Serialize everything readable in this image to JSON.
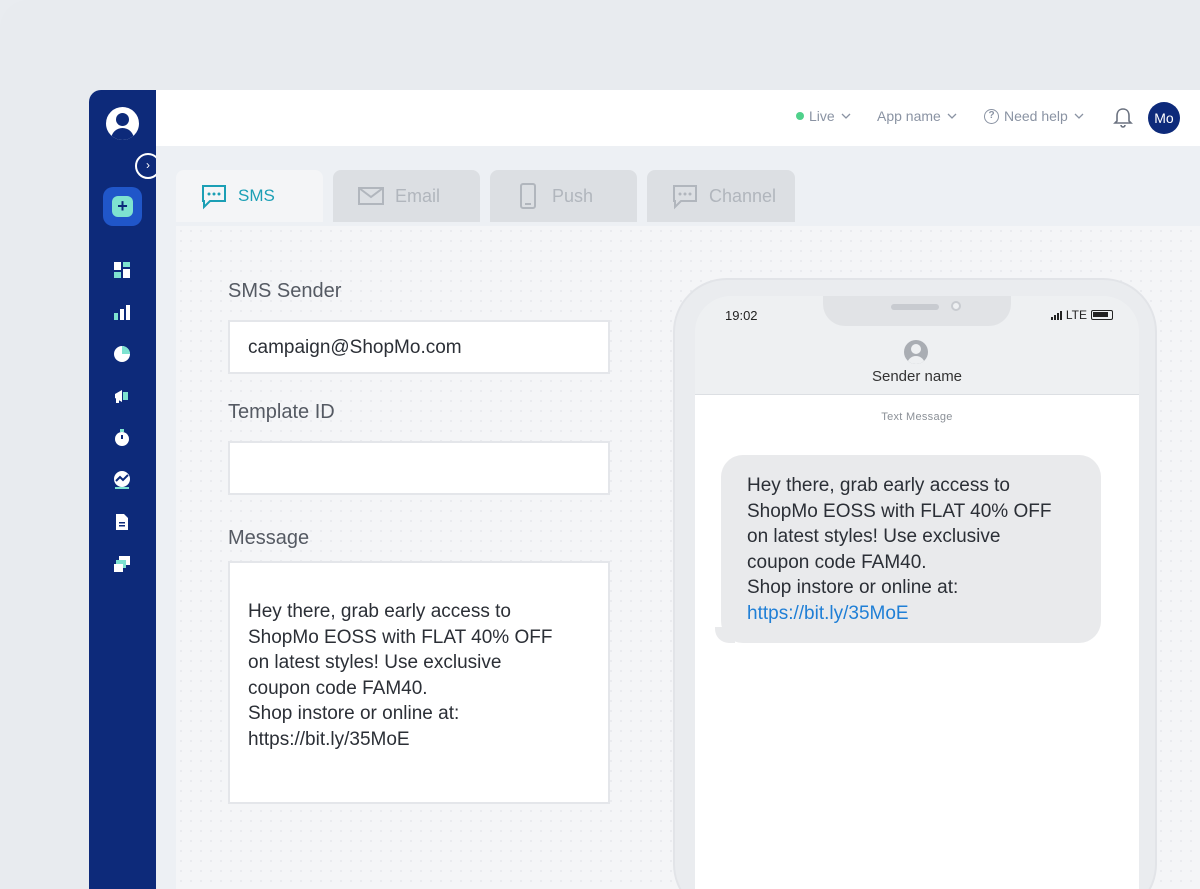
{
  "topbar": {
    "status_label": "Live",
    "app_label": "App name",
    "help_label": "Need help",
    "user_initials": "Mo",
    "status_color": "#4fd18b"
  },
  "sidebar": {
    "nav_icons": [
      "dashboard-icon",
      "analytics-icon",
      "segments-icon",
      "campaigns-icon",
      "flows-icon",
      "insights-icon",
      "content-icon",
      "templates-icon"
    ]
  },
  "tabs": [
    {
      "label": "SMS",
      "icon": "sms-icon",
      "active": true
    },
    {
      "label": "Email",
      "icon": "email-icon",
      "active": false
    },
    {
      "label": "Push",
      "icon": "push-icon",
      "active": false
    },
    {
      "label": "Channel",
      "icon": "channel-icon",
      "active": false
    }
  ],
  "form": {
    "sender_label": "SMS Sender",
    "sender_value": "campaign@ShopMo.com",
    "template_label": "Template ID",
    "template_value": "",
    "message_label": "Message",
    "message_value": "Hey there, grab early access to\nShopMo EOSS with FLAT 40% OFF\non latest styles! Use exclusive\ncoupon code FAM40.\nShop instore or online at:\nhttps://bit.ly/35MoE"
  },
  "phone": {
    "time": "19:02",
    "network": "LTE",
    "sender_name": "Sender name",
    "thread_label": "Text Message",
    "bubble_text": "Hey there, grab early access to\nShopMo EOSS with FLAT 40% OFF\non latest styles! Use exclusive\ncoupon code FAM40.\nShop instore or online at:",
    "bubble_link": "https://bit.ly/35MoE"
  },
  "colors": {
    "sidebar": "#0d2a7a",
    "accent": "#1b9fb5",
    "link": "#1f7fd6"
  }
}
